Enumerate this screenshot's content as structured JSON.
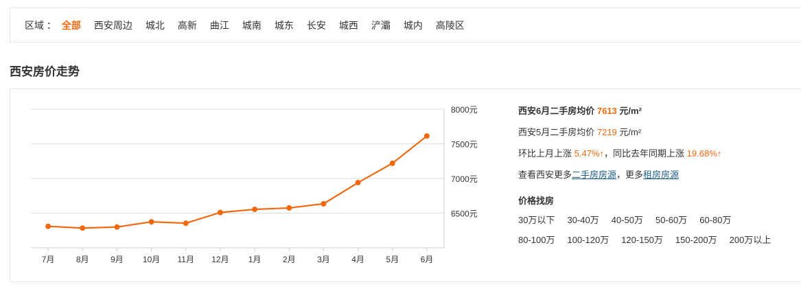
{
  "region": {
    "label": "区域 ：",
    "items": [
      "全部",
      "西安周边",
      "城北",
      "高新",
      "曲江",
      "城南",
      "城东",
      "长安",
      "城西",
      "浐灞",
      "城内",
      "高陵区"
    ],
    "active_index": 0
  },
  "section_title": "西安房价走势",
  "summary": {
    "cur_prefix": "西安6月二手房均价",
    "cur_value": "7613",
    "cur_unit": "元/m²",
    "prev_prefix": "西安5月二手房均价",
    "prev_value": "7219",
    "prev_unit": "元/m²",
    "mom_prefix": "环比上月上涨",
    "mom_value": "5.47%",
    "yoy_prefix": "，同比去年同期上涨",
    "yoy_value": "19.68%",
    "arrow": "↑",
    "more_prefix": "查看西安更多",
    "more_link1": "二手房房源",
    "more_mid": "，更多",
    "more_link2": "租房房源"
  },
  "price_filter": {
    "title": "价格找房",
    "row1": [
      "30万以下",
      "30-40万",
      "40-50万",
      "50-60万",
      "60-80万"
    ],
    "row2": [
      "80-100万",
      "100-120万",
      "120-150万",
      "150-200万",
      "200万以上"
    ]
  },
  "colors": {
    "accent": "#f0690f",
    "link": "#1f5e8e",
    "grid": "#dddddd"
  },
  "chart_data": {
    "type": "line",
    "categories": [
      "7月",
      "8月",
      "9月",
      "10月",
      "11月",
      "12月",
      "1月",
      "2月",
      "3月",
      "4月",
      "5月",
      "6月"
    ],
    "values": [
      6310,
      6285,
      6300,
      6375,
      6355,
      6510,
      6555,
      6575,
      6635,
      6940,
      7219,
      7613
    ],
    "ylim": [
      6000,
      8000
    ],
    "yticks": [
      6500,
      7000,
      7500,
      8000
    ],
    "ytick_suffix": "元",
    "grid": true,
    "legend": "none"
  }
}
